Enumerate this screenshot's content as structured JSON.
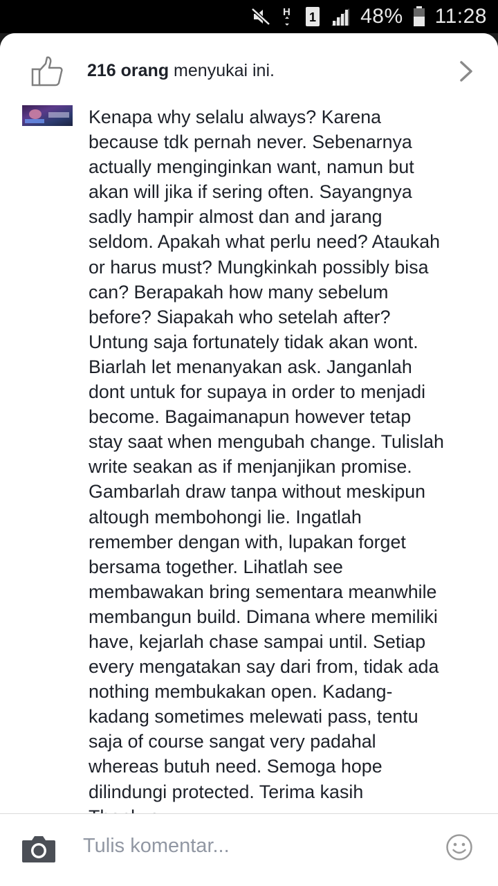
{
  "status_bar": {
    "battery": "48%",
    "time": "11:28",
    "icons": [
      "mute-icon",
      "h-plus-data-icon",
      "sim-1-icon",
      "signal-icon",
      "battery-icon"
    ]
  },
  "likes": {
    "count": "216 orang",
    "suffix": " menyukai ini."
  },
  "comment": {
    "text": "Kenapa why selalu always? Karena\nbecause tdk pernah never. Sebenarnya\nactually menginginkan want, namun but\nakan will jika if sering often. Sayangnya\nsadly hampir almost dan and jarang\nseldom. Apakah what perlu need? Ataukah\nor harus must? Mungkinkah possibly bisa\ncan? Berapakah how many sebelum\nbefore? Siapakah who setelah after?\nUntung saja fortunately tidak akan wont.\nBiarlah let menanyakan ask. Janganlah\ndont untuk for supaya in order to menjadi\nbecome. Bagaimanapun however tetap\nstay saat when mengubah change. Tulislah\nwrite seakan as if menjanjikan promise.\nGambarlah draw tanpa without meskipun\naltough membohongi lie. Ingatlah\nremember dengan with, lupakan forget\nbersama together. Lihatlah see\nmembawakan bring sementara meanwhile\nmembangun build. Dimana where memiliki\nhave, kejarlah chase sampai until. Setiap\nevery mengatakan say dari from, tidak ada\nnothing membukakan open. Kadang-\nkadang sometimes melewati pass, tentu\nsaja of course sangat very padahal\nwhereas butuh need. Semoga hope\ndilindungi protected. Terima kasih\nThankyou"
  },
  "composer": {
    "placeholder": "Tulis komentar..."
  },
  "colors": {
    "text": "#1d2129",
    "placeholder": "#9197a3",
    "icon_gray": "#7f7f7f"
  }
}
